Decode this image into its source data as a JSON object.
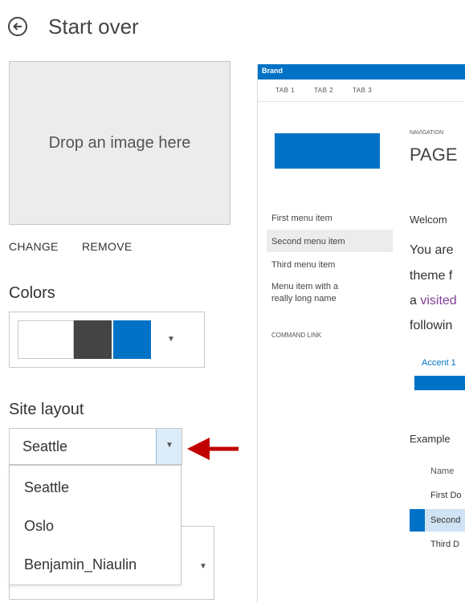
{
  "header": {
    "back_label": "Start over"
  },
  "image_drop": {
    "placeholder": "Drop an image here",
    "change_label": "CHANGE",
    "remove_label": "REMOVE"
  },
  "colors": {
    "title": "Colors",
    "swatches": [
      "#ffffff",
      "#444444",
      "#0072c6"
    ]
  },
  "site_layout": {
    "title": "Site layout",
    "selected": "Seattle",
    "options": [
      "Seattle",
      "Oslo",
      "Benjamin_Niaulin"
    ]
  },
  "preview": {
    "brand": "Brand",
    "tabs": [
      "TAB 1",
      "TAB 2",
      "TAB 3"
    ],
    "nav_label": "NAVIGATION",
    "page_title": "PAGE",
    "menu": [
      "First menu item",
      "Second menu item",
      "Third menu item",
      "Menu item with a",
      "really long name"
    ],
    "command_link": "COMMAND LINK",
    "welcome": "Welcom",
    "body_lines": [
      "You are",
      "theme f",
      "a ",
      "visited",
      "followin"
    ],
    "accent_label": "Accent 1",
    "example": "Example",
    "table": {
      "header": "Name",
      "rows": [
        "First Do",
        "Second",
        "Third D"
      ]
    },
    "accent_color": "#0072c6"
  },
  "annotation": {
    "arrow_color": "#c00000"
  }
}
